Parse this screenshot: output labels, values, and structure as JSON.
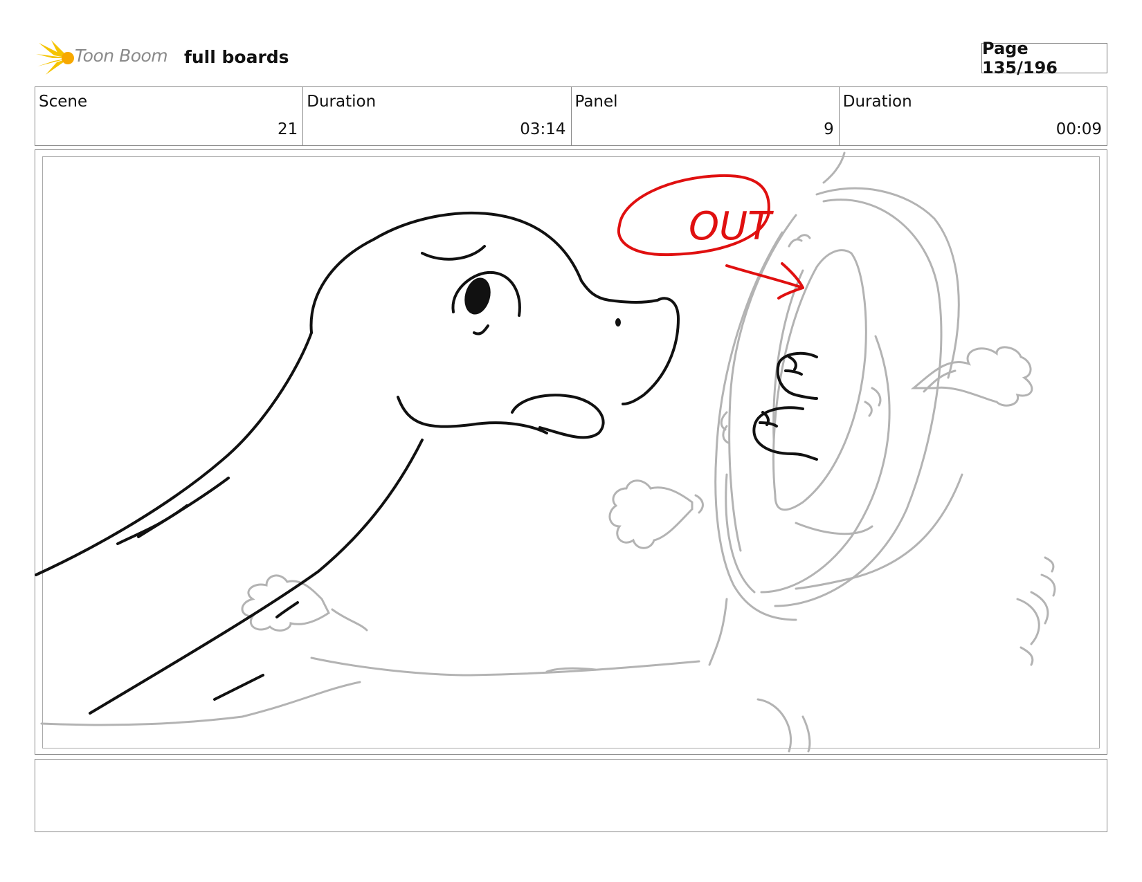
{
  "header": {
    "logo_text": "Toon Boom",
    "project_title": "full boards",
    "page_indicator": "Page 135/196"
  },
  "info": {
    "scene_label": "Scene",
    "scene_value": "21",
    "scene_duration_label": "Duration",
    "scene_duration_value": "03:14",
    "panel_label": "Panel",
    "panel_value": "9",
    "panel_duration_label": "Duration",
    "panel_duration_value": "00:09"
  },
  "panel": {
    "annotation_text": "OUT",
    "ink_color": "#111111",
    "background_sketch_color": "#b3b3b3",
    "annotation_color": "#e01010"
  },
  "notes": {
    "text": ""
  },
  "colors": {
    "logo_accent": "#f5c400",
    "border": "#888888"
  }
}
